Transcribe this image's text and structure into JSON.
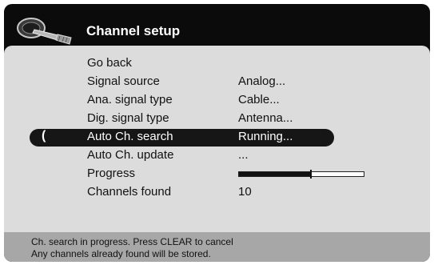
{
  "header": {
    "title": "Channel setup",
    "logo_icon": "satellite-dish-icon"
  },
  "menu": {
    "items": [
      {
        "label": "Go back",
        "value": ""
      },
      {
        "label": "Signal source",
        "value": "Analog..."
      },
      {
        "label": "Ana. signal type",
        "value": "Cable..."
      },
      {
        "label": "Dig. signal type",
        "value": "Antenna..."
      },
      {
        "label": "Auto Ch. search",
        "value": "Running..."
      },
      {
        "label": "Auto Ch. update",
        "value": "..."
      },
      {
        "label": "Progress",
        "value": ""
      },
      {
        "label": "Channels found",
        "value": "10"
      }
    ],
    "selected_index": 4,
    "cursor_glyph": "("
  },
  "progress": {
    "fraction": 0.58
  },
  "footer": {
    "line1": "Ch. search in progress. Press CLEAR to cancel",
    "line2": "Any channels already found will be stored."
  },
  "colors": {
    "background": "#0b0b0b",
    "panel": "#dcdcdc",
    "footer": "#a7a7a7",
    "highlight": "#161616",
    "text": "#111111",
    "highlight_text": "#ffffff"
  }
}
